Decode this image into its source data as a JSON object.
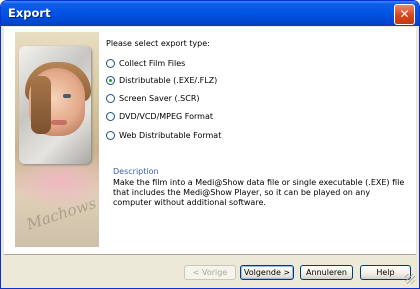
{
  "window": {
    "title": "Export",
    "close_glyph": "✕"
  },
  "photo": {
    "watermark": "Machows N"
  },
  "form": {
    "heading": "Please select export type:",
    "options": [
      {
        "label": "Collect Film Files",
        "checked": false
      },
      {
        "label": "Distributable (.EXE/.FLZ)",
        "checked": true
      },
      {
        "label": "Screen Saver (.SCR)",
        "checked": false
      },
      {
        "label": "DVD/VCD/MPEG Format",
        "checked": false
      },
      {
        "label": "Web Distributable Format",
        "checked": false
      }
    ]
  },
  "description": {
    "title": "Description",
    "text": "Make the film into a Medi@Show data file or single executable (.EXE) file that includes the Medi@Show Player, so it can be played on any computer without additional software."
  },
  "buttons": {
    "back": "< Vorige",
    "next": "Volgende >",
    "cancel": "Annuleren",
    "help": "Help"
  }
}
